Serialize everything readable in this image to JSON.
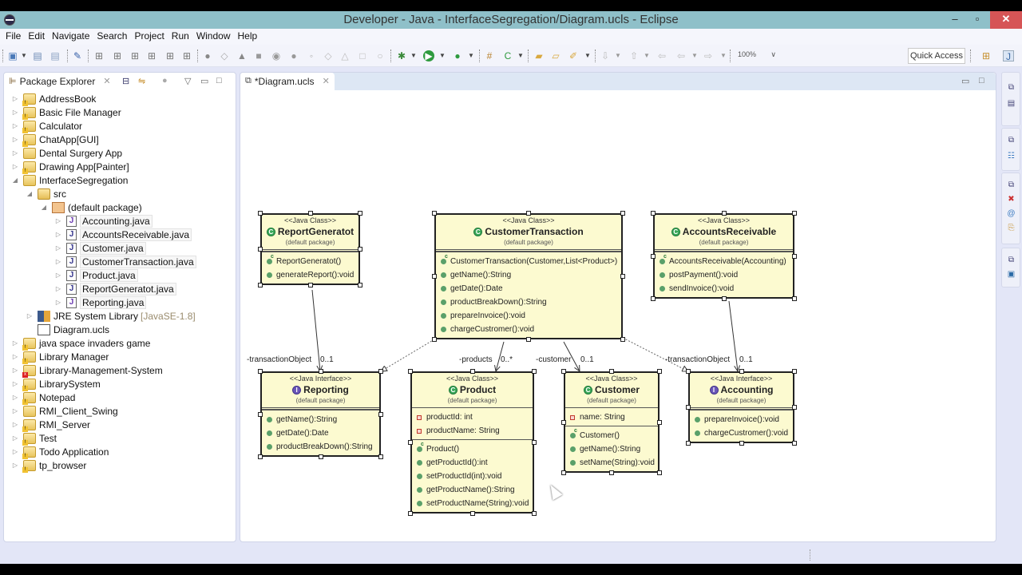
{
  "window": {
    "title": "Developer - Java - InterfaceSegregation/Diagram.ucls - Eclipse",
    "minimize": "–",
    "maximize": "▫",
    "close": "✕"
  },
  "menu": [
    "File",
    "Edit",
    "Navigate",
    "Search",
    "Project",
    "Run",
    "Window",
    "Help"
  ],
  "toolbar": {
    "zoom_value": "100%",
    "quick_access": "Quick Access"
  },
  "package_explorer": {
    "title": "Package Explorer",
    "items": [
      {
        "label": "AddressBook",
        "kind": "project",
        "status": "warning",
        "level": 0,
        "expanded": false
      },
      {
        "label": "Basic File Manager",
        "kind": "project",
        "status": "warning",
        "level": 0,
        "expanded": false
      },
      {
        "label": "Calculator",
        "kind": "project",
        "status": "warning",
        "level": 0,
        "expanded": false
      },
      {
        "label": "ChatApp[GUI]",
        "kind": "project",
        "status": "warning",
        "level": 0,
        "expanded": false
      },
      {
        "label": "Dental Surgery App",
        "kind": "project",
        "status": "none",
        "level": 0,
        "expanded": false
      },
      {
        "label": "Drawing App[Painter]",
        "kind": "project",
        "status": "warning",
        "level": 0,
        "expanded": false
      },
      {
        "label": "InterfaceSegregation",
        "kind": "project",
        "status": "none",
        "level": 0,
        "expanded": true
      },
      {
        "label": "src",
        "kind": "src",
        "level": 1,
        "expanded": true
      },
      {
        "label": "(default package)",
        "kind": "package",
        "level": 2,
        "expanded": true
      },
      {
        "label": "Accounting.java",
        "kind": "interface-file",
        "level": 3,
        "expanded": false
      },
      {
        "label": "AccountsReceivable.java",
        "kind": "class-file",
        "level": 3,
        "expanded": false
      },
      {
        "label": "Customer.java",
        "kind": "class-file",
        "level": 3,
        "expanded": false
      },
      {
        "label": "CustomerTransaction.java",
        "kind": "class-file",
        "level": 3,
        "expanded": false
      },
      {
        "label": "Product.java",
        "kind": "class-file",
        "level": 3,
        "expanded": false
      },
      {
        "label": "ReportGeneratot.java",
        "kind": "class-file",
        "level": 3,
        "expanded": false
      },
      {
        "label": "Reporting.java",
        "kind": "interface-file",
        "level": 3,
        "expanded": false
      },
      {
        "label": "JRE System Library",
        "suffix": "[JavaSE-1.8]",
        "kind": "library",
        "level": 1,
        "expanded": false
      },
      {
        "label": "Diagram.ucls",
        "kind": "diagram",
        "level": 1
      },
      {
        "label": "java space invaders game",
        "kind": "project",
        "status": "warning",
        "level": 0,
        "expanded": false
      },
      {
        "label": "Library Manager",
        "kind": "project",
        "status": "warning",
        "level": 0,
        "expanded": false
      },
      {
        "label": "Library-Management-System",
        "kind": "project",
        "status": "error",
        "level": 0,
        "expanded": false
      },
      {
        "label": "LibrarySystem",
        "kind": "project",
        "status": "warning",
        "level": 0,
        "expanded": false
      },
      {
        "label": "Notepad",
        "kind": "project",
        "status": "warning",
        "level": 0,
        "expanded": false
      },
      {
        "label": "RMI_Client_Swing",
        "kind": "project",
        "status": "none",
        "level": 0,
        "expanded": false
      },
      {
        "label": "RMI_Server",
        "kind": "project",
        "status": "warning",
        "level": 0,
        "expanded": false
      },
      {
        "label": "Test",
        "kind": "project",
        "status": "warning",
        "level": 0,
        "expanded": false
      },
      {
        "label": "Todo Application",
        "kind": "project",
        "status": "warning",
        "level": 0,
        "expanded": false
      },
      {
        "label": "tp_browser",
        "kind": "project",
        "status": "warning",
        "level": 0,
        "expanded": false
      }
    ]
  },
  "editor": {
    "tab_label": "*Diagram.ucls",
    "classes": {
      "report_generatot": {
        "stereotype": "<<Java Class>>",
        "name": "ReportGeneratot",
        "package": "(default package)",
        "methods": [
          {
            "text": "ReportGeneratot()",
            "kind": "ctor"
          },
          {
            "text": "generateReport():void",
            "kind": "public"
          }
        ]
      },
      "customer_transaction": {
        "stereotype": "<<Java Class>>",
        "name": "CustomerTransaction",
        "package": "(default package)",
        "methods": [
          {
            "text": "CustomerTransaction(Customer,List<Product>)",
            "kind": "ctor"
          },
          {
            "text": "getName():String",
            "kind": "public"
          },
          {
            "text": "getDate():Date",
            "kind": "public"
          },
          {
            "text": "productBreakDown():String",
            "kind": "public"
          },
          {
            "text": "prepareInvoice():void",
            "kind": "public"
          },
          {
            "text": "chargeCustromer():void",
            "kind": "public"
          }
        ]
      },
      "accounts_receivable": {
        "stereotype": "<<Java Class>>",
        "name": "AccountsReceivable",
        "package": "(default package)",
        "methods": [
          {
            "text": "AccountsReceivable(Accounting)",
            "kind": "ctor"
          },
          {
            "text": "postPayment():void",
            "kind": "public"
          },
          {
            "text": "sendInvoice():void",
            "kind": "public"
          }
        ]
      },
      "reporting": {
        "stereotype": "<<Java Interface>>",
        "name": "Reporting",
        "package": "(default package)",
        "methods": [
          {
            "text": "getName():String",
            "kind": "public"
          },
          {
            "text": "getDate():Date",
            "kind": "public"
          },
          {
            "text": "productBreakDown():String",
            "kind": "public"
          }
        ]
      },
      "product": {
        "stereotype": "<<Java Class>>",
        "name": "Product",
        "package": "(default package)",
        "fields": [
          {
            "text": "productId: int"
          },
          {
            "text": "productName: String"
          }
        ],
        "methods": [
          {
            "text": "Product()",
            "kind": "ctor"
          },
          {
            "text": "getProductId():int",
            "kind": "public"
          },
          {
            "text": "setProductId(int):void",
            "kind": "public"
          },
          {
            "text": "getProductName():String",
            "kind": "public"
          },
          {
            "text": "setProductName(String):void",
            "kind": "public"
          }
        ]
      },
      "customer": {
        "stereotype": "<<Java Class>>",
        "name": "Customer",
        "package": "(default package)",
        "fields": [
          {
            "text": "name: String"
          }
        ],
        "methods": [
          {
            "text": "Customer()",
            "kind": "ctor"
          },
          {
            "text": "getName():String",
            "kind": "public"
          },
          {
            "text": "setName(String):void",
            "kind": "public"
          }
        ]
      },
      "accounting": {
        "stereotype": "<<Java Interface>>",
        "name": "Accounting",
        "package": "(default package)",
        "methods": [
          {
            "text": "prepareInvoice():void",
            "kind": "public"
          },
          {
            "text": "chargeCustromer():void",
            "kind": "public"
          }
        ]
      }
    },
    "connector_labels": {
      "report_role": "-transactionObject",
      "report_mult": "0..1",
      "products_role": "-products",
      "products_mult": "0..*",
      "customer_role": "-customer",
      "customer_mult": "0..1",
      "accounting_role": "-transactionObject",
      "accounting_mult": "0..1"
    }
  }
}
